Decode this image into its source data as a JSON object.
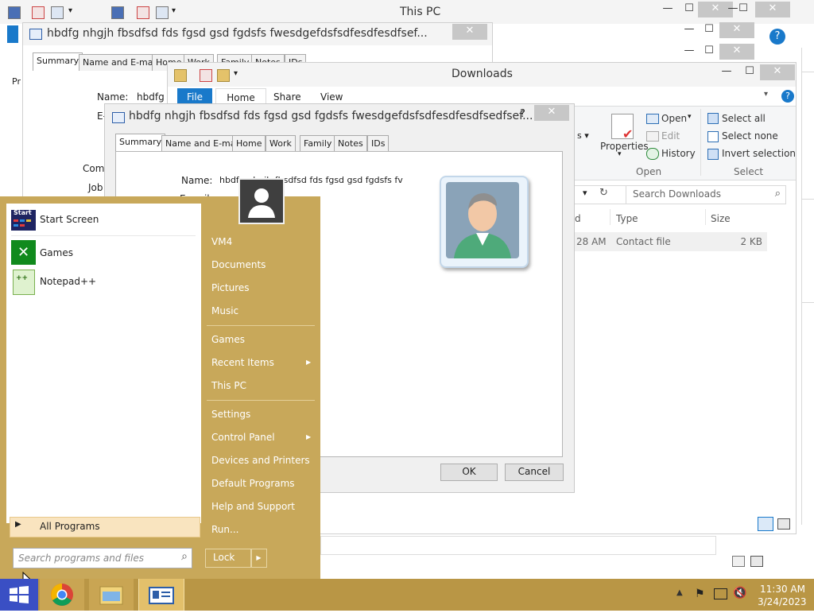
{
  "this_pc_window": {
    "title": "This PC"
  },
  "contact_dialog_back": {
    "title": "hbdfg nhgjh fbsdfsd fds fgsd gsd fgdsfs fwesdgefdsfsdfesdfesdfsef...",
    "help": "?",
    "tabs": [
      "Summary",
      "Name and E-mail",
      "Home",
      "Work",
      "Family",
      "Notes",
      "IDs"
    ],
    "name_label": "Name:",
    "name_value": "hbdfg",
    "email_label": "E-",
    "company_label": "Com",
    "job_label": "Job"
  },
  "downloads_window": {
    "title": "Downloads",
    "ribbon_tabs": [
      "File",
      "Home",
      "Share",
      "View"
    ],
    "open_label": "Open",
    "edit_label": "Edit",
    "history_label": "History",
    "properties_label": "Properties",
    "open_group": "Open",
    "select_all": "Select all",
    "select_none": "Select none",
    "invert_selection": "Invert selection",
    "select_group": "Select",
    "search_placeholder": "Search Downloads",
    "columns": {
      "date_tail": "d",
      "type": "Type",
      "size": "Size"
    },
    "row": {
      "date_tail": "28 AM",
      "type": "Contact file",
      "size": "2 KB"
    }
  },
  "contact_dialog_front": {
    "title": "hbdfg nhgjh fbsdfsd fds fgsd gsd fgdsfs fwesdgefdsfsdfesdfesdfsedfsef...",
    "help": "?",
    "tabs": [
      "Summary",
      "Name and E-mail",
      "Home",
      "Work",
      "Family",
      "Notes",
      "IDs"
    ],
    "name_label": "Name:",
    "name_value": "hbdfg nhgjh fbsdfsd fds fgsd gsd fgdsfs fv",
    "email_label": "E-mail:",
    "ok": "OK",
    "cancel": "Cancel"
  },
  "start_menu": {
    "pinned": [
      {
        "label": "Start Screen",
        "icon": "start-screen-icon"
      },
      {
        "label": "Games",
        "icon": "games-icon"
      },
      {
        "label": "Notepad++",
        "icon": "notepadpp-icon"
      }
    ],
    "all_programs": "All Programs",
    "search_placeholder": "Search programs and files",
    "right_items": [
      "VM4",
      "Documents",
      "Pictures",
      "Music",
      "Games",
      "Recent Items",
      "This PC",
      "Settings",
      "Control Panel",
      "Devices and Printers",
      "Default Programs",
      "Help and Support",
      "Run..."
    ],
    "lock": "Lock"
  },
  "taskbar": {
    "time": "11:30 AM",
    "date": "3/24/2023"
  },
  "colors": {
    "accent": "#c8a85a",
    "taskbar": "#b99645",
    "file_tab": "#1979ca",
    "start_highlight": "#f9e4bf"
  }
}
